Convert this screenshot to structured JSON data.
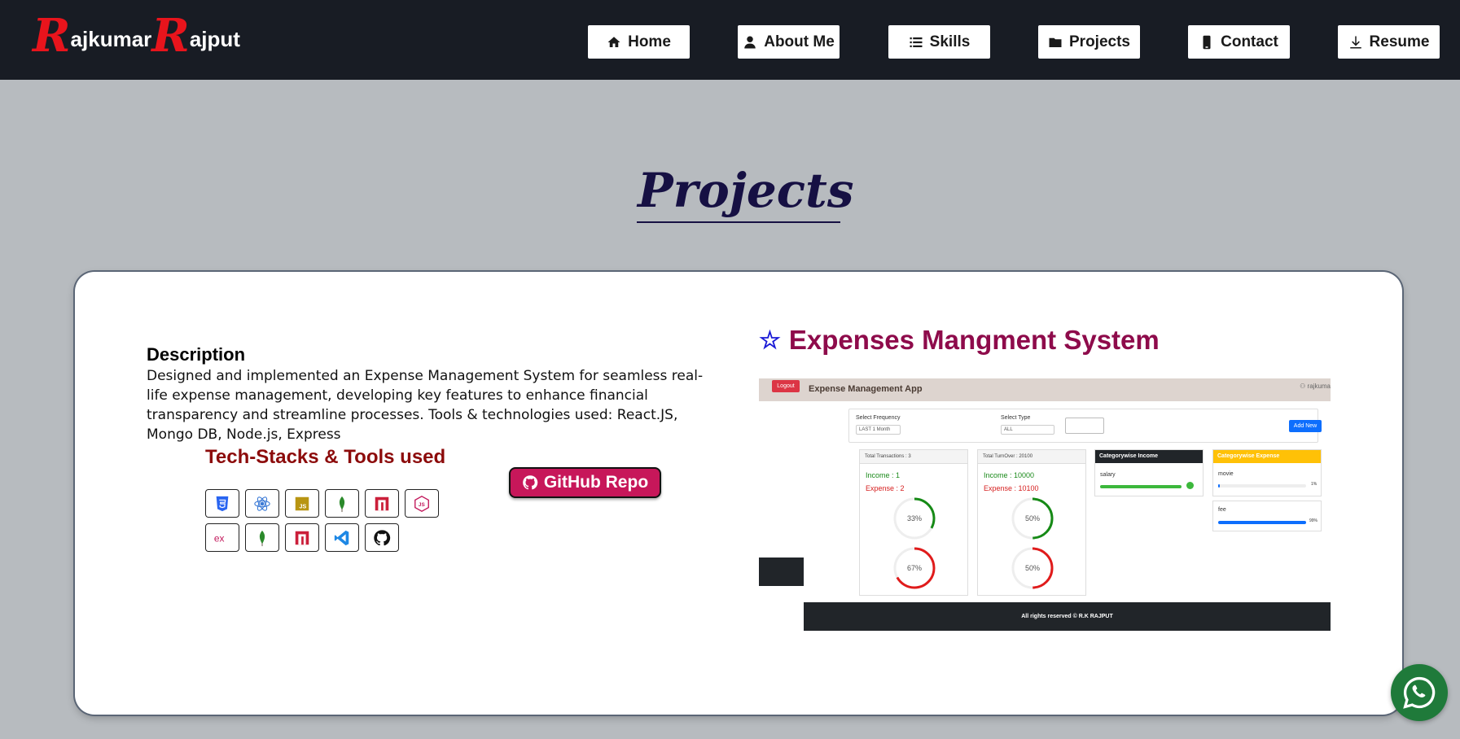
{
  "logo": {
    "first_initial": "R",
    "first_rest": "ajkumar",
    "last_initial": "R",
    "last_rest": "ajput"
  },
  "nav": [
    {
      "label": "Home",
      "icon": "home-icon"
    },
    {
      "label": "About Me",
      "icon": "user-icon"
    },
    {
      "label": "Skills",
      "icon": "list-icon"
    },
    {
      "label": "Projects",
      "icon": "folder-icon"
    },
    {
      "label": "Contact",
      "icon": "phone-icon"
    },
    {
      "label": "Resume",
      "icon": "download-icon"
    }
  ],
  "section": {
    "title": "Projects"
  },
  "project": {
    "star": "☆",
    "title": "Expenses Mangment System",
    "description_heading": "Description",
    "description": "Designed and implemented an Expense Management System for seamless real-life expense management, developing key features to enhance financial transparency and streamline processes. Tools & technologies used: React.JS, Mongo DB, Node.js, Express",
    "stack_heading": "Tech-Stacks & Tools used",
    "tech_icons": [
      "css3-icon",
      "react-icon",
      "javascript-icon",
      "mongodb-icon",
      "npm-icon",
      "nodejs-icon",
      "express-icon",
      "mongodb-icon",
      "npm-icon",
      "vscode-icon",
      "github-icon"
    ],
    "github_label": "GitHub Repo"
  },
  "screenshot": {
    "logout": "Logout",
    "app_title": "Expense Management App",
    "user": "rajkuma",
    "select_frequency_label": "Select Frequency",
    "select_frequency_value": "LAST 1 Month",
    "select_type_label": "Select Type",
    "select_type_value": "ALL",
    "add_new": "Add New",
    "total_transactions": "Total Transactions : 3",
    "income_count": "Income : 1",
    "expense_count": "Expense : 2",
    "pct_income_count": "33%",
    "pct_expense_count": "67%",
    "total_turnover": "Total TurnOver : 20100",
    "income_amount": "Income : 10000",
    "expense_amount": "Expense : 10100",
    "pct_income_amount": "50%",
    "pct_expense_amount": "50%",
    "cat_income_title": "Categorywise Income",
    "cat_income_item": "salary",
    "cat_expense_title": "Categorywise Expense",
    "cat_expense_item1": "movie",
    "cat_expense_item1_pct": "1%",
    "cat_expense_item2": "fee",
    "cat_expense_item2_pct": "99%",
    "footer": "All rights reserved © R.K RAJPUT"
  },
  "colors": {
    "navbar": "#181c24",
    "page_bg": "#b7bbbf",
    "title": "#161043",
    "project_title": "#8e0b4b",
    "stack_title": "#8c0b0b",
    "github_btn": "#c7175a",
    "whatsapp": "#1f7a3a"
  }
}
